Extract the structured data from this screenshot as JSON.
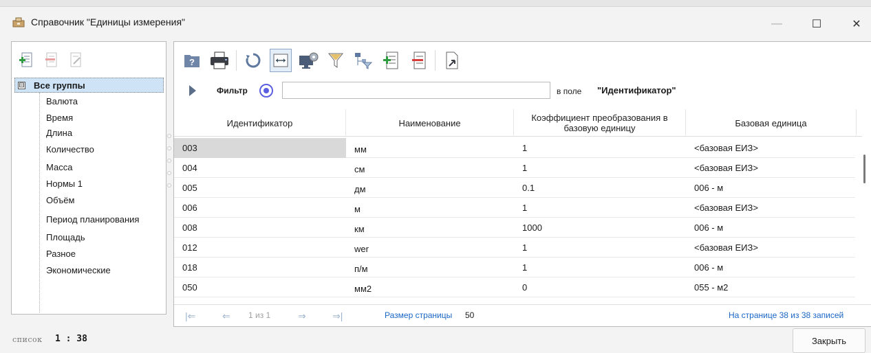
{
  "window": {
    "title": "Справочник \"Единицы измерения\"",
    "min_glyph": "—",
    "max_glyph": "☐",
    "close_glyph": "✕"
  },
  "tree": {
    "root": "Все группы",
    "expander": "⊟",
    "groups": [
      "Валюта",
      "Время",
      "Длина",
      "Количество",
      "Масса",
      "Нормы 1",
      "Объём",
      "Период планирования",
      "Площадь",
      "Разное",
      "Экономические"
    ]
  },
  "left_toolbar": [
    "add-group-icon",
    "remove-group-icon",
    "edit-group-icon"
  ],
  "toolbar": [
    "help-icon",
    "print-icon",
    "refresh-icon",
    "fit-columns-icon",
    "display-settings-icon",
    "filter-icon",
    "tree-filter-icon",
    "add-record-icon",
    "delete-record-icon",
    "export-icon"
  ],
  "filter": {
    "label": "Фильтр",
    "value": "",
    "field_prefix": "в поле",
    "field_name": "\"Идентификатор\""
  },
  "grid": {
    "columns": [
      "Идентификатор",
      "Наименование",
      "Коэффициент преобразования в базовую единицу",
      "Базовая единица"
    ],
    "rows": [
      [
        "003",
        "мм",
        "1",
        "<базовая ЕИЗ>"
      ],
      [
        "004",
        "см",
        "1",
        "<базовая ЕИЗ>"
      ],
      [
        "005",
        "дм",
        "0.1",
        "006 - м"
      ],
      [
        "006",
        "м",
        "1",
        "<базовая ЕИЗ>"
      ],
      [
        "008",
        "км",
        "1000",
        "006 - м"
      ],
      [
        "012",
        "wer",
        "1",
        "<базовая ЕИЗ>"
      ],
      [
        "018",
        "п/м",
        "1",
        "006 - м"
      ],
      [
        "050",
        "мм2",
        "0",
        "055 - м2"
      ]
    ]
  },
  "pager": {
    "first": "|⇐",
    "prev": "⇐",
    "page_info": "1 из 1",
    "next": "⇒",
    "last": "⇒|",
    "size_label": "Размер страницы",
    "size_value": "50",
    "records": "На странице 38 из 38 записей"
  },
  "status": {
    "label": "список",
    "value": "1 : 38"
  },
  "close_button": "Закрыть"
}
